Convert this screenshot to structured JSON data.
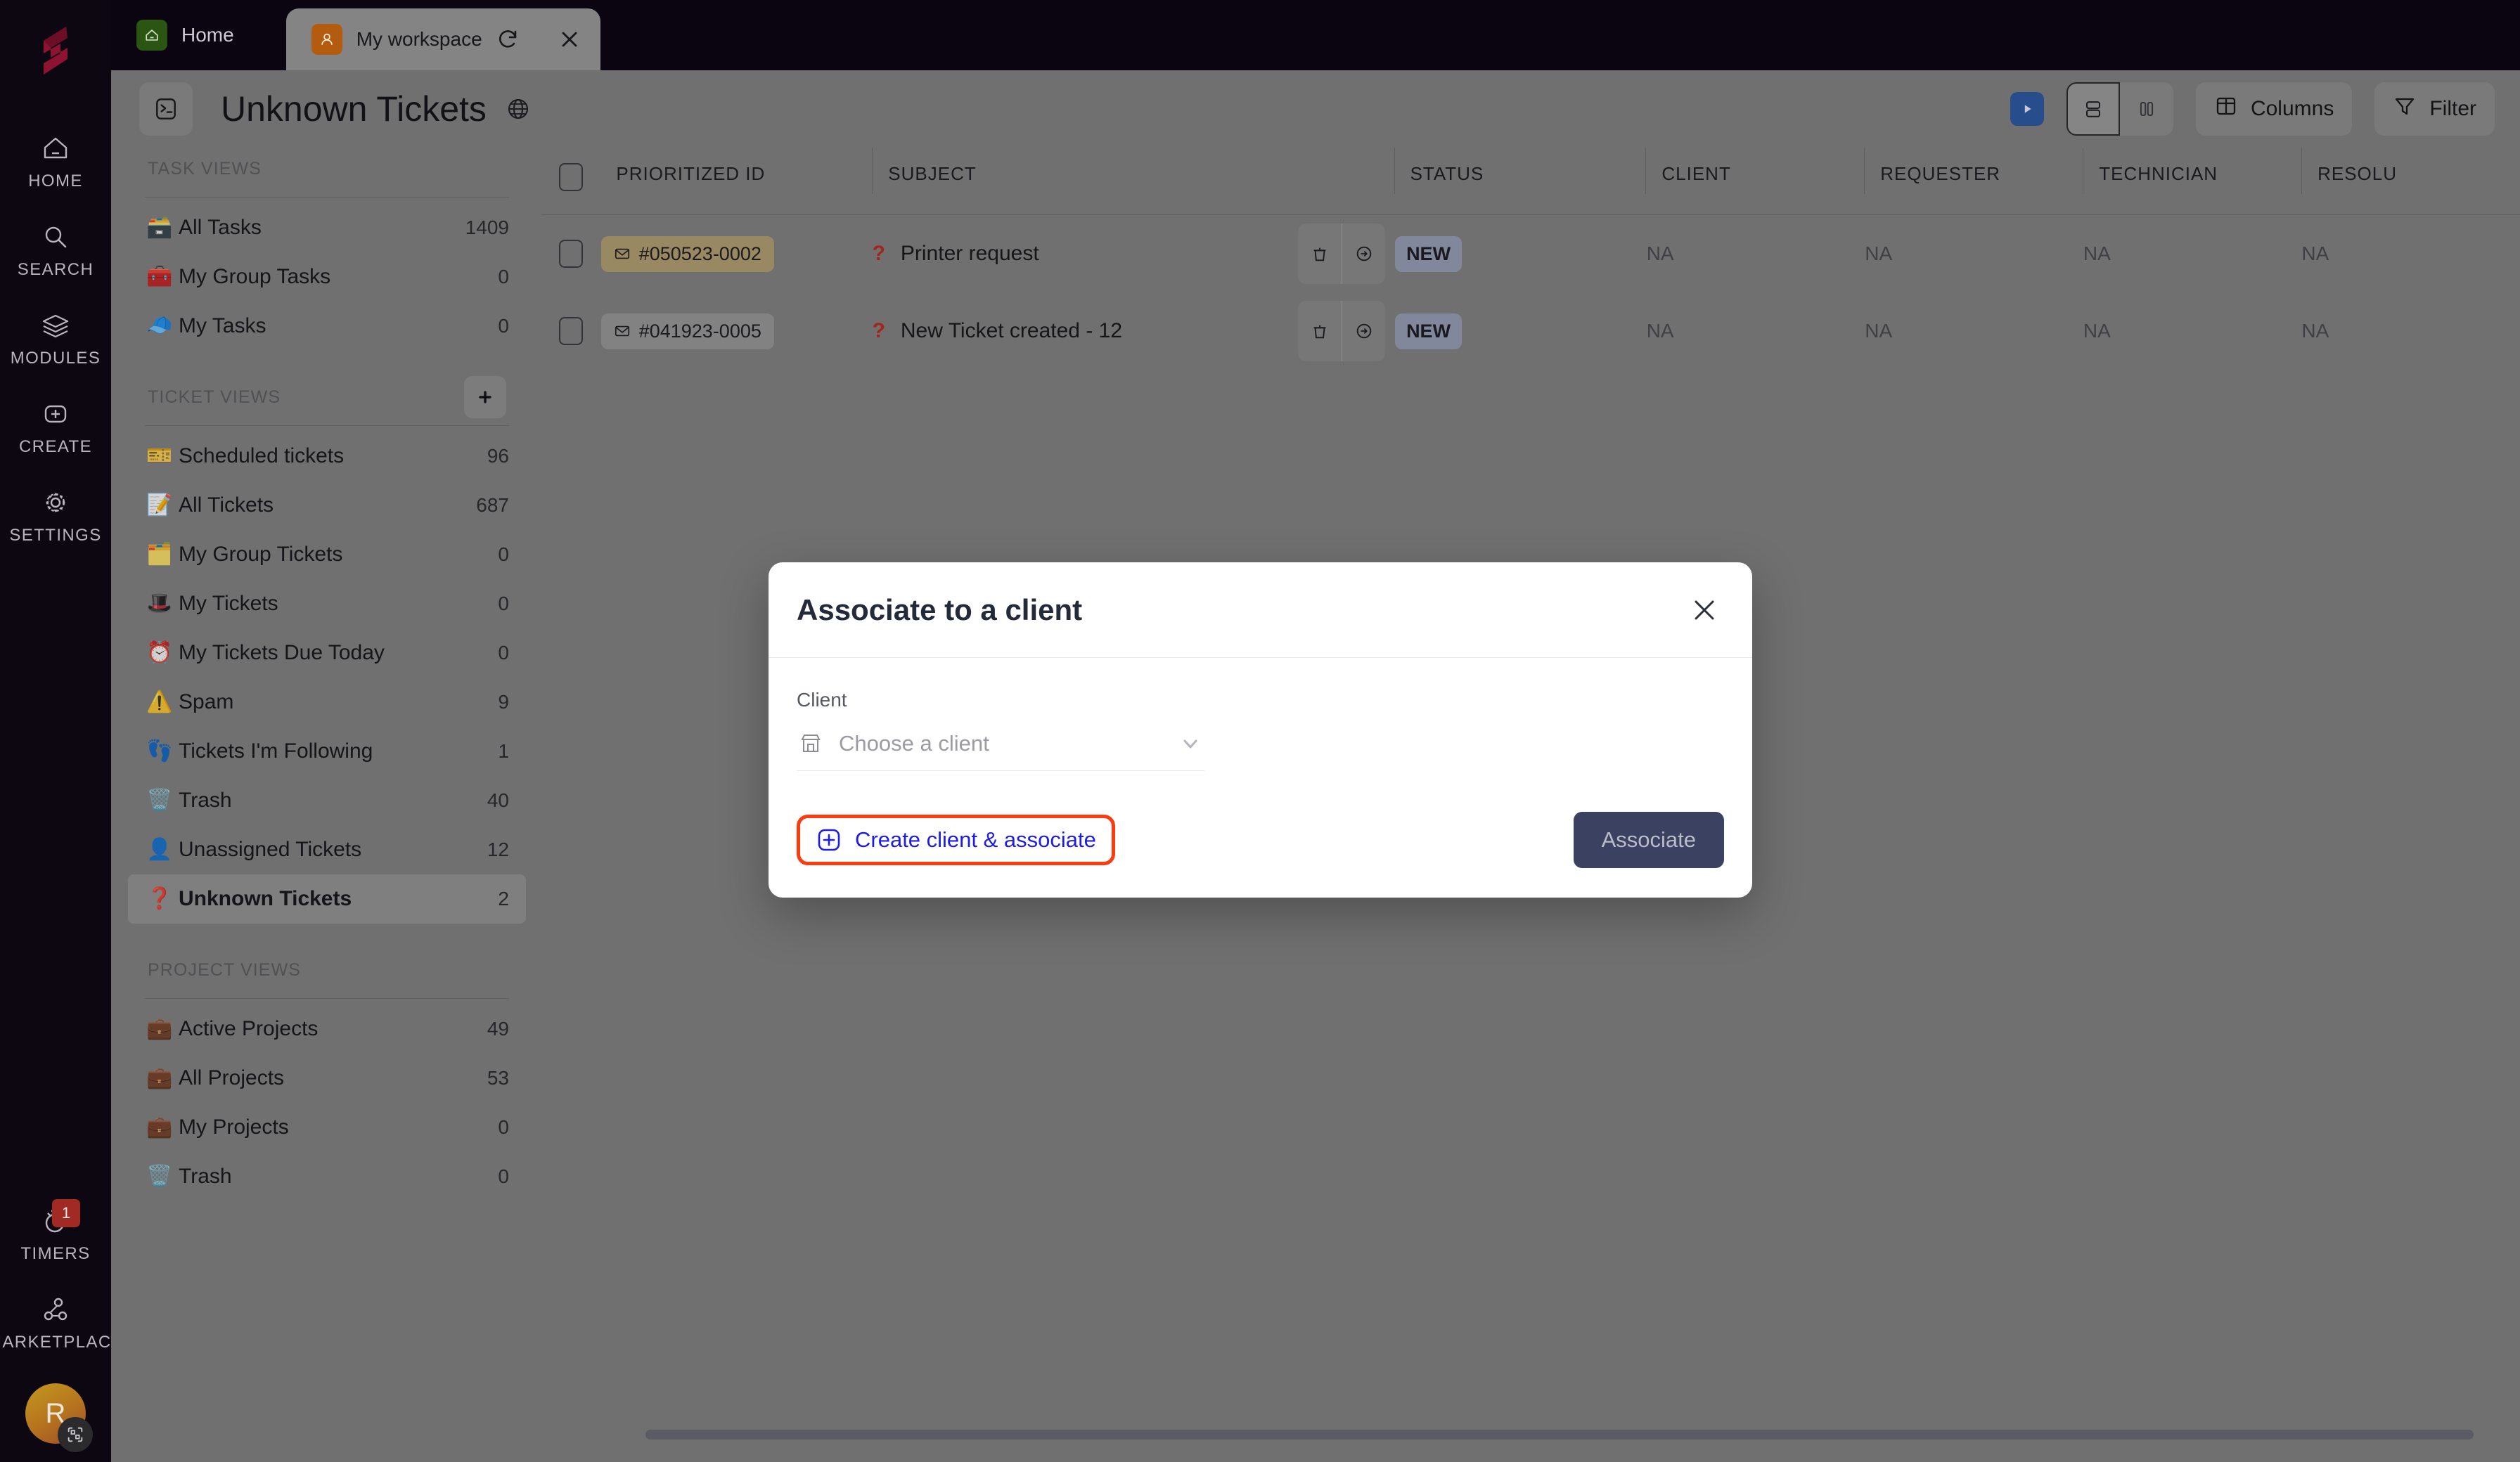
{
  "rail": {
    "logo_name": "app-logo",
    "items": [
      {
        "label": "HOME",
        "icon": "home-icon"
      },
      {
        "label": "SEARCH",
        "icon": "search-icon"
      },
      {
        "label": "MODULES",
        "icon": "layers-icon"
      },
      {
        "label": "CREATE",
        "icon": "plus-square-icon"
      },
      {
        "label": "SETTINGS",
        "icon": "gear-icon"
      }
    ],
    "bottom": [
      {
        "label": "TIMERS",
        "icon": "stopwatch-icon",
        "badge": "1"
      },
      {
        "label": "MARKETPLACE",
        "icon": "share-nodes-icon",
        "badge": ""
      }
    ],
    "avatar_initial": "R"
  },
  "tabs": [
    {
      "label": "Home",
      "icon": "home-tab-icon",
      "active": false
    },
    {
      "label": "My workspace",
      "icon": "user-tab-icon",
      "active": true
    }
  ],
  "header": {
    "terminal_icon": "terminal-icon",
    "title": "Unknown Tickets",
    "globe_icon": "globe-icon",
    "play_icon": "play-icon",
    "view_rows_icon": "rows-view-icon",
    "view_board_icon": "board-view-icon",
    "columns_label": "Columns",
    "columns_icon": "columns-icon",
    "filter_label": "Filter",
    "filter_icon": "filter-icon"
  },
  "sidebar": {
    "sections": [
      {
        "title": "TASK VIEWS",
        "add_button": false,
        "items": [
          {
            "emoji": "🗃️",
            "label": "All Tasks",
            "count": "1409",
            "active": false
          },
          {
            "emoji": "🧰",
            "label": "My Group Tasks",
            "count": "0",
            "active": false
          },
          {
            "emoji": "🧢",
            "label": "My Tasks",
            "count": "0",
            "active": false
          }
        ]
      },
      {
        "title": "TICKET VIEWS",
        "add_button": true,
        "items": [
          {
            "emoji": "🎫",
            "label": "Scheduled tickets",
            "count": "96",
            "active": false
          },
          {
            "emoji": "📝",
            "label": "All Tickets",
            "count": "687",
            "active": false
          },
          {
            "emoji": "🗂️",
            "label": "My Group Tickets",
            "count": "0",
            "active": false
          },
          {
            "emoji": "🎩",
            "label": "My Tickets",
            "count": "0",
            "active": false
          },
          {
            "emoji": "⏰",
            "label": "My Tickets Due Today",
            "count": "0",
            "active": false
          },
          {
            "emoji": "⚠️",
            "label": "Spam",
            "count": "9",
            "active": false
          },
          {
            "emoji": "👣",
            "label": "Tickets I'm Following",
            "count": "1",
            "active": false
          },
          {
            "emoji": "🗑️",
            "label": "Trash",
            "count": "40",
            "active": false
          },
          {
            "emoji": "👤",
            "label": "Unassigned Tickets",
            "count": "12",
            "active": false
          },
          {
            "emoji": "❓",
            "label": "Unknown Tickets",
            "count": "2",
            "active": true
          }
        ]
      },
      {
        "title": "PROJECT VIEWS",
        "add_button": false,
        "items": [
          {
            "emoji": "💼",
            "label": "Active Projects",
            "count": "49",
            "active": false
          },
          {
            "emoji": "💼",
            "label": "All Projects",
            "count": "53",
            "active": false
          },
          {
            "emoji": "💼",
            "label": "My Projects",
            "count": "0",
            "active": false
          },
          {
            "emoji": "🗑️",
            "label": "Trash",
            "count": "0",
            "active": false
          }
        ]
      }
    ]
  },
  "table": {
    "columns": [
      "PRIORITIZED ID",
      "SUBJECT",
      "STATUS",
      "CLIENT",
      "REQUESTER",
      "TECHNICIAN",
      "RESOLU"
    ],
    "rows": [
      {
        "id": "#050523-0002",
        "id_style": "gold",
        "subject": "Printer request",
        "status": "NEW",
        "client": "NA",
        "requester": "NA",
        "technician": "NA",
        "resolution": "NA"
      },
      {
        "id": "#041923-0005",
        "id_style": "grey",
        "subject": "New Ticket created - 12",
        "status": "NEW",
        "client": "NA",
        "requester": "NA",
        "technician": "NA",
        "resolution": "NA"
      }
    ]
  },
  "modal": {
    "title": "Associate to a client",
    "close_icon": "close-icon",
    "field_label": "Client",
    "field_icon": "store-icon",
    "field_placeholder": "Choose a client",
    "caret_icon": "chevron-down-icon",
    "create_label": "Create client & associate",
    "create_icon": "plus-circle-icon",
    "associate_label": "Associate",
    "highlight_color": "#fa3c10",
    "link_color": "#1c1ce8",
    "button_color": "#3b4160"
  }
}
